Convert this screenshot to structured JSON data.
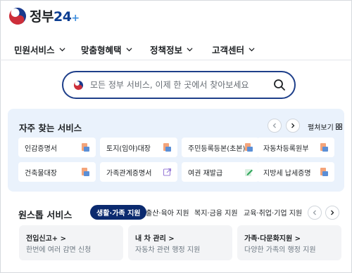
{
  "header": {
    "logo_text": "정부",
    "logo_num": "24",
    "logo_plus": "+"
  },
  "nav": {
    "items": [
      {
        "label": "민원서비스"
      },
      {
        "label": "맞춤형혜택"
      },
      {
        "label": "정책정보"
      },
      {
        "label": "고객센터"
      }
    ]
  },
  "search": {
    "placeholder": "모든 정부 서비스, 이제 한 곳에서 찾아보세요"
  },
  "frequent": {
    "title": "자주 찾는 서비스",
    "expand_label": "펼쳐보기",
    "services": [
      {
        "label": "인감증명서",
        "icon": "document-icon"
      },
      {
        "label": "토지(임야)대장",
        "icon": "document-icon"
      },
      {
        "label": "주민등록등본(초본)",
        "icon": "document-icon"
      },
      {
        "label": "자동차등록원부",
        "icon": "document-icon"
      },
      {
        "label": "건축물대장",
        "icon": "document-icon"
      },
      {
        "label": "가족관계증명서",
        "icon": "external-link-icon"
      },
      {
        "label": "여권 재발급",
        "icon": "edit-icon"
      },
      {
        "label": "지방세 납세증명",
        "icon": "document-icon"
      }
    ]
  },
  "onestop": {
    "title": "원스톱 서비스",
    "tabs": [
      {
        "label": "생활·가족 지원",
        "active": true
      },
      {
        "label": "출산·육아 지원",
        "active": false
      },
      {
        "label": "복지·금융 지원",
        "active": false
      },
      {
        "label": "교육·취업·기업 지원",
        "active": false
      }
    ],
    "cards": [
      {
        "title": "전입신고+ >",
        "desc": "한번에 여러 감면 신청"
      },
      {
        "title": "내 차 관리 >",
        "desc": "자동차 관련 행정 지원"
      },
      {
        "title": "가족·다문화지원 >",
        "desc": "다양한 가족의 행정 지원"
      }
    ]
  },
  "colors": {
    "brand_navy": "#0b2a6f",
    "search_border": "#1e3f8a",
    "panel_bg": "#eaf2fc",
    "card_bg": "#f3f4f6"
  }
}
